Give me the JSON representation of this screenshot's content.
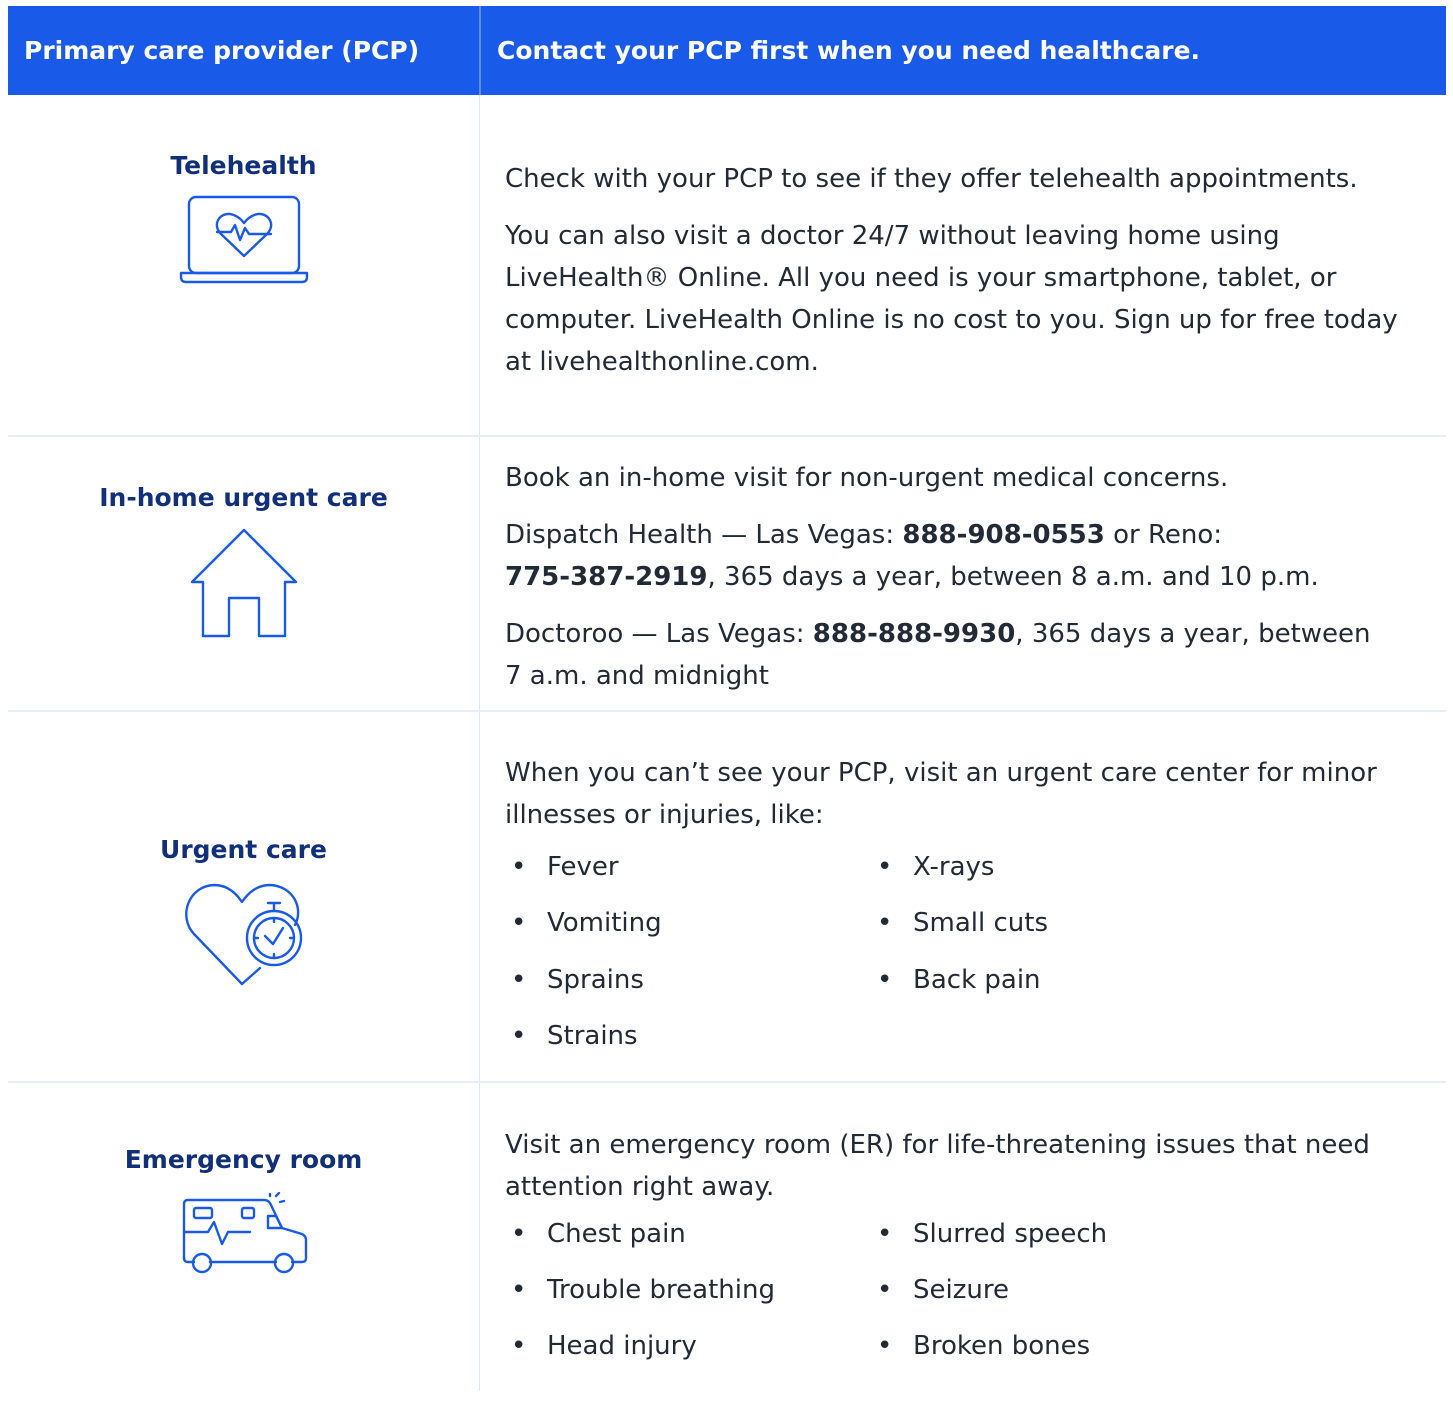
{
  "header": {
    "left": "Primary care provider (PCP)",
    "right": "Contact your PCP first when you need healthcare."
  },
  "rows": [
    {
      "title": "Telehealth",
      "icon": "laptop-heart-icon",
      "paragraphs": [
        "Check with your PCP to see if they offer telehealth appointments.",
        "You can also visit a doctor 24/7 without leaving home using LiveHealth®  Online. All you need is your smartphone, tablet, or computer. LiveHealth Online is no cost to you. Sign up for free today at livehealthonline.com."
      ]
    },
    {
      "title": "In-home urgent care",
      "icon": "house-icon",
      "intro": "Book an in-home visit for non-urgent medical concerns.",
      "dispatch": {
        "prefix": "Dispatch Health — Las Vegas: ",
        "phone1": "888-908-0553",
        "middle": " or Reno:",
        "phone2": "775-387-2919",
        "suffix": ", 365 days a year, between 8 a.m. and 10 p.m."
      },
      "doctoroo": {
        "prefix": "Doctoroo — Las Vegas: ",
        "phone": "888-888-9930",
        "suffix": ", 365 days a year, between",
        "line2": "7 a.m. and midnight"
      }
    },
    {
      "title": "Urgent care",
      "icon": "heart-stopwatch-icon",
      "intro": "When you can’t see your PCP, visit an urgent care center for minor illnesses or injuries, like:",
      "bullets_left": [
        "Fever",
        "Vomiting",
        "Sprains",
        "Strains"
      ],
      "bullets_right": [
        "X-rays",
        "Small cuts",
        "Back pain"
      ]
    },
    {
      "title": "Emergency room",
      "icon": "ambulance-icon",
      "intro": "Visit an emergency room (ER) for life-threatening issues that need attention right away.",
      "bullets_left": [
        "Chest pain",
        "Trouble breathing",
        "Head injury"
      ],
      "bullets_right": [
        "Slurred speech",
        "Seizure",
        "Broken bones"
      ]
    }
  ],
  "colors": {
    "header_bg": "#1a5ae8",
    "title_navy": "#12307a",
    "icon_blue": "#1a5ae8",
    "body_text": "#222a35"
  },
  "bullet_glyph": "•"
}
